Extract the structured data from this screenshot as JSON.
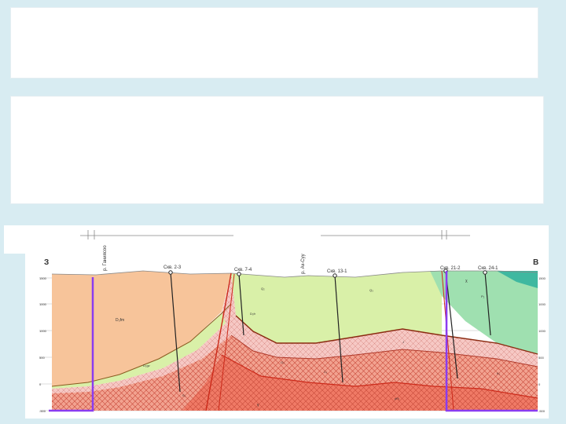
{
  "slide": {
    "colors": {
      "background": "#d8ecf2",
      "panel": "#ffffff",
      "layer_orange": "#f7c49a",
      "layer_lightgreen": "#d9f0a8",
      "layer_green": "#9fe0b0",
      "layer_teal": "#3fb8a0",
      "layer_pink": "#f6c8c4",
      "layer_salmon": "#f2a290",
      "layer_red": "#f07a66",
      "fault": "#cc2a1a",
      "marker": "#8a3cf0"
    }
  },
  "section": {
    "left_letter": "З",
    "right_letter": "В",
    "river_left": "р. Ганиясоо",
    "river_right": "р. Ак-Суу",
    "wells": [
      {
        "name": "Скв. 2-3"
      },
      {
        "name": "Скв. 7-4"
      },
      {
        "name": "Скв. 13-1"
      },
      {
        "name": "Скв. 21-2"
      },
      {
        "name": "Скв. 24-1"
      }
    ],
    "depth_ticks_left": [
      "1500",
      "1000",
      "1000",
      "500",
      "0",
      "-500"
    ],
    "depth_ticks_right": [
      "1500",
      "1000",
      "1000",
      "500",
      "0",
      "-500"
    ],
    "layer_labels": [
      "Q₂",
      "Q₃",
      "P₂",
      "D₃fm",
      "D₃fr",
      "D₂gv",
      "S₁",
      "O₃",
      "C₁",
      "J",
      "K₁",
      "pR₁",
      "γ",
      "χ"
    ]
  }
}
